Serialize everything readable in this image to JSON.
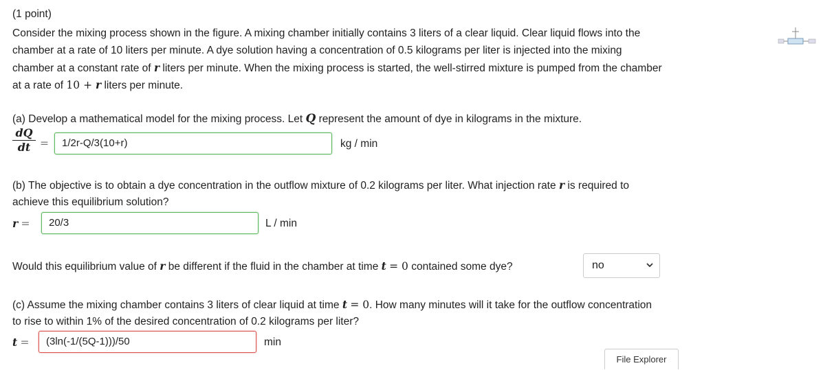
{
  "point_label": "(1 point)",
  "intro": {
    "line1": "Consider the mixing process shown in the figure. A mixing chamber initially contains 3 liters of a clear liquid. Clear liquid flows into the",
    "line2": "chamber at a rate of 10 liters per minute. A dye solution having a concentration of 0.5 kilograms per liter is injected into the mixing",
    "line3_a": "chamber at a constant rate of",
    "line3_var": "r",
    "line3_b": "liters per minute. When the mixing process is started, the well-stirred mixture is pumped from the chamber",
    "line4_a": "at a rate of",
    "line4_math_num": "10 + ",
    "line4_math_var": "r",
    "line4_b": "liters per minute."
  },
  "part_a": {
    "text_a": "(a) Develop a mathematical model for the mixing process. Let",
    "var": "Q",
    "text_b": "represent the amount of dye in kilograms in the mixture.",
    "frac_num": "dQ",
    "frac_den": "dt",
    "equals": "=",
    "answer": "1/2r-Q/3(10+r)",
    "unit": "kg / min"
  },
  "part_b": {
    "line1_a": "(b) The objective is to obtain a dye concentration in the outflow mixture of 0.2 kilograms per liter. What injection rate",
    "line1_var": "r",
    "line1_b": "is required to",
    "line2": "achieve this equilibrium solution?",
    "lhs_var": "r",
    "equals": "=",
    "answer": "20/3",
    "unit": "L / min"
  },
  "question_equilibrium": {
    "text_a": "Would this equilibrium value of",
    "var_r": "r",
    "text_b": "be different if the fluid in the chamber at time",
    "var_t": "t",
    "math_eq": "= 0",
    "text_c": "contained some dye?",
    "select_value": "no"
  },
  "part_c": {
    "line1_a": "(c) Assume the mixing chamber contains 3 liters of clear liquid at time",
    "line1_var": "t",
    "line1_math": "= 0",
    "line1_b": ". How many minutes will it take for the outflow concentration",
    "line2": "to rise to within 1% of the desired concentration of 0.2 kilograms per liter?",
    "lhs_var": "t",
    "equals": "=",
    "answer": "(3ln(-1/(5Q-1)))/50",
    "unit": "min"
  },
  "tooltip": "File Explorer",
  "colors": {
    "correct_border": "#5cb85c",
    "incorrect_border": "#d9534f"
  },
  "icons": {
    "figure": "mixing-chamber-figure-thumbnail",
    "dropdown": "chevron-down-icon"
  }
}
